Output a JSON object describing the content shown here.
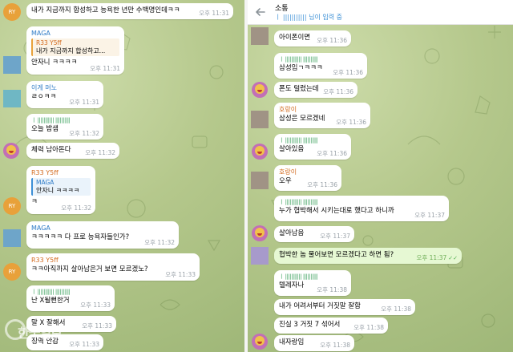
{
  "colors": {
    "bubble_in": "#ffffff",
    "bubble_out": "#e6f8d3",
    "accent_blue": "#3a8fd6",
    "time_gray": "#9aa2a9",
    "name_orange": "#d36b1f",
    "name_green": "#3aa05c",
    "name_blue": "#2e7bc6",
    "name_teal": "#2e8fa0"
  },
  "left": {
    "messages": [
      {
        "sender": "",
        "text": "내가 지금까지 합성하고 능욕한 년만 수백명인데ㅋㅋ",
        "time": "오후 11:31"
      },
      {
        "sender": "MAGA",
        "quote_sender": "R33 Y5ff",
        "quote_text": "내가 지금까지 합성하고...",
        "text": "안자니 ㅋㅋㅋㅋ",
        "time": "오후 11:31"
      },
      {
        "sender": "이게 머노",
        "text": "ㄹㅇㅋㅋ",
        "time": "오후 11:31"
      },
      {
        "sender": "",
        "barcode": "ㅣ ||||||||||| ||||||||||",
        "text": "오늘 밤샘",
        "time": "오후 11:32"
      },
      {
        "sender": "",
        "text": "체력 남아돈다",
        "time": "오후 11:32"
      },
      {
        "sender": "R33 Y5ff",
        "quote_sender": "MAGA",
        "quote_text": "안자니 ㅋㅋㅋㅋ",
        "text": "ㅋ",
        "time": "오후 11:32"
      },
      {
        "sender": "MAGA",
        "text": "ㅋㅋㅋㅋㅋ 다 프로 능욕자들인가?",
        "time": "오후 11:32"
      },
      {
        "sender": "R33 Y5ff",
        "text": "ㅋㅋ아직까지 살아남은거 보면 모르겠노?",
        "time": "오후 11:33"
      },
      {
        "sender": "",
        "barcode": "ㅣ ||||||||||| ||||||||||",
        "text": "난 X될뻔한거",
        "time": "오후 11:33"
      },
      {
        "sender": "",
        "text": "말 X 잘해서",
        "time": "오후 11:33"
      },
      {
        "sender": "",
        "text": "징역 안감",
        "time": "오후 11:33"
      }
    ],
    "avatar_initials": "RY",
    "watermark": "한국일보"
  },
  "right": {
    "header": {
      "back_icon": "arrow-left-icon",
      "title": "소통",
      "typing": "ㅣ ||||||||||| 님이 입력 중"
    },
    "messages": [
      {
        "sender": "",
        "text": "아이폰이면",
        "time": "오후 11:36"
      },
      {
        "sender": "",
        "barcode": "ㅣ ||||||||||| ||||||||||",
        "text": "삼성임ㄱㅋㅋㅋ",
        "time": "오후 11:36"
      },
      {
        "sender": "",
        "text": "폰도 털렸는데",
        "time": "오후 11:36"
      },
      {
        "sender": "호랑이",
        "text": "삼성은 모르겠네",
        "time": "오후 11:36"
      },
      {
        "sender": "",
        "barcode": "ㅣ ||||||||||| ||||||||||",
        "text": "살아있음",
        "time": "오후 11:36"
      },
      {
        "sender": "호랑이",
        "text": "오우",
        "time": "오후 11:36"
      },
      {
        "sender": "",
        "barcode": "ㅣ ||||||||||| ||||||||||",
        "text": "누가 협박해서 시키는대로 했다고 하니까",
        "time": "오후 11:37"
      },
      {
        "sender": "",
        "text": "살아남음",
        "time": "오후 11:37"
      },
      {
        "sender": "",
        "text": "협박한 놈 물어보면 모르겠다고 하면 됨?",
        "time": "오후 11:37",
        "outgoing": true
      },
      {
        "sender": "",
        "barcode": "ㅣ ||||||||||| ||||||||||",
        "text": "텔레자나",
        "time": "오후 11:38"
      },
      {
        "sender": "",
        "text": "내가 어려서부터 거짓말 잘함",
        "time": "오후 11:38"
      },
      {
        "sender": "",
        "text": "진실 3 거짓 7 섞어서",
        "time": "오후 11:38"
      },
      {
        "sender": "",
        "text": "내자랑임",
        "time": "오후 11:38"
      }
    ],
    "tick_icon": "✓✓"
  }
}
